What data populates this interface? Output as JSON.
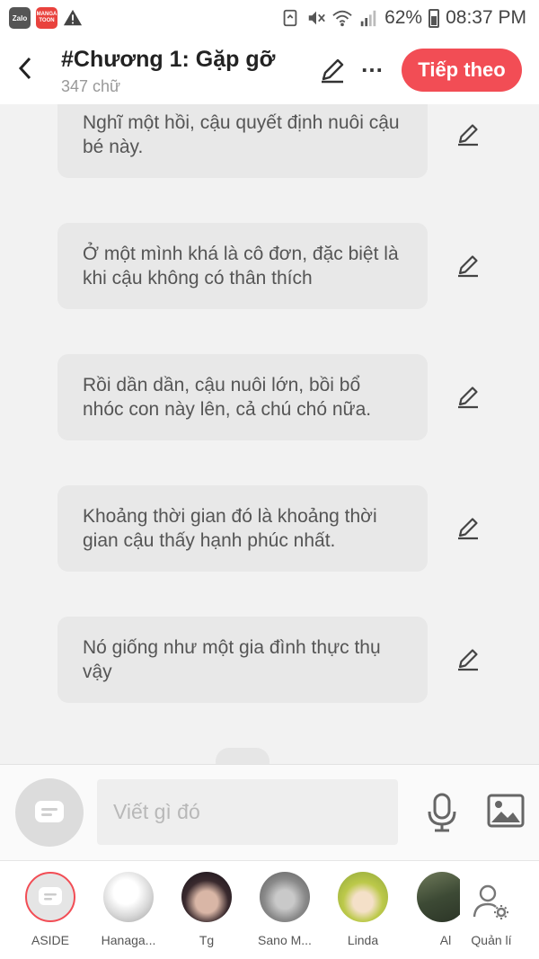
{
  "status_bar": {
    "apps": [
      "Zalo",
      "MANGA TOON"
    ],
    "battery": "62%",
    "time": "08:37 PM"
  },
  "header": {
    "title": "#Chương 1: Gặp gỡ",
    "word_count": "347 chữ",
    "next_label": "Tiếp theo"
  },
  "lines": [
    "Nghĩ một hồi, cậu quyết định nuôi cậu bé này.",
    "Ở một mình khá là cô đơn, đặc biệt là khi cậu không có thân thích",
    "Rồi dần dần, cậu nuôi lớn, bồi bổ nhóc con này lên, cả chú chó nữa.",
    "Khoảng thời gian đó là khoảng thời gian cậu thấy hạnh phúc nhất.",
    "Nó giống như một gia đình thực thụ vậy"
  ],
  "composer": {
    "placeholder": "Viết gì đó"
  },
  "characters": [
    {
      "name": "ASIDE",
      "avatar": "aside-icon"
    },
    {
      "name": "Hanaga...",
      "avatar": "sketch-portrait"
    },
    {
      "name": "Tg",
      "avatar": "dark-portrait"
    },
    {
      "name": "Sano M...",
      "avatar": "grey-portrait"
    },
    {
      "name": "Linda",
      "avatar": "green-hair-portrait"
    },
    {
      "name": "Al",
      "avatar": "forest-portrait"
    }
  ],
  "manage_label": "Quản lí",
  "colors": {
    "accent": "#f24d55",
    "bubble": "#e8e8e8",
    "background": "#f2f2f2"
  }
}
